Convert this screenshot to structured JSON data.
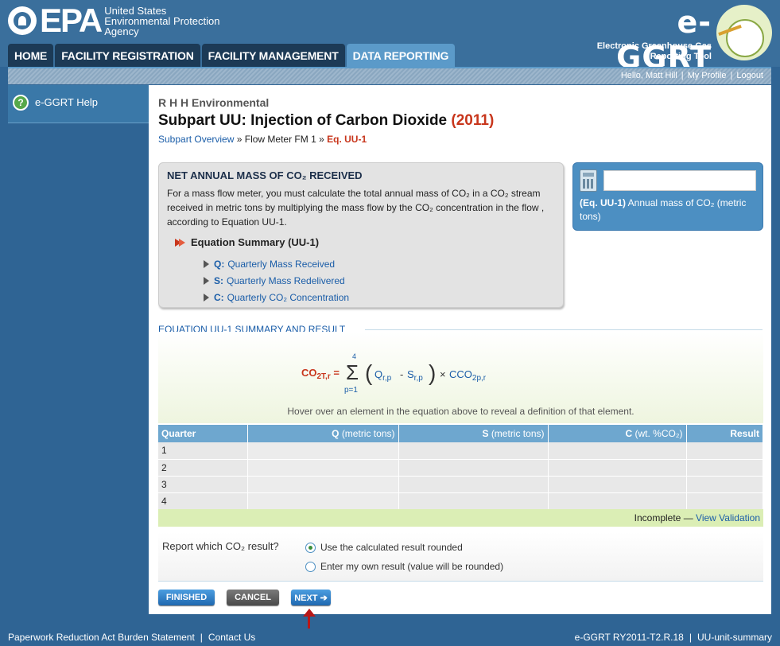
{
  "header": {
    "epa_word": "EPA",
    "agency_line1": "United States",
    "agency_line2": "Environmental Protection",
    "agency_line3": "Agency",
    "app_title": "e-GGRT",
    "app_subtitle_line1": "Electronic Greenhouse Gas",
    "app_subtitle_line2": "Reporting Tool"
  },
  "nav": {
    "tabs": [
      {
        "label": "HOME"
      },
      {
        "label": "FACILITY REGISTRATION"
      },
      {
        "label": "FACILITY MANAGEMENT"
      },
      {
        "label": "DATA REPORTING"
      }
    ],
    "active_index": 3
  },
  "user_bar": {
    "greeting": "Hello, Matt Hill",
    "profile": "My Profile",
    "logout": "Logout"
  },
  "sidebar": {
    "help_label": "e-GGRT Help"
  },
  "main": {
    "facility": "R H H Environmental",
    "title": "Subpart UU: Injection of Carbon Dioxide",
    "year": "(2011)",
    "breadcrumb": {
      "link1": "Subpart Overview",
      "sep": "»",
      "item2": "Flow Meter FM 1",
      "current": "Eq. UU-1"
    }
  },
  "info_box": {
    "title": "NET ANNUAL MASS OF CO₂ RECEIVED",
    "text": "For a mass flow meter, you must calculate the total annual mass of CO₂ in a CO₂ stream received in metric tons by multiplying the mass flow by the CO₂ concentration in the flow , according to Equation UU-1.",
    "summary_head": "Equation Summary (UU-1)",
    "items": [
      {
        "key": "Q:",
        "label": "Quarterly Mass Received"
      },
      {
        "key": "S:",
        "label": "Quarterly Mass Redelivered"
      },
      {
        "key": "C:",
        "label": "Quarterly CO₂ Concentration"
      }
    ]
  },
  "result_box": {
    "input_value": "",
    "label_bold": "(Eq. UU-1)",
    "label": "Annual mass of CO₂ (metric tons)"
  },
  "equation": {
    "section_title": "EQUATION UU-1 SUMMARY AND RESULT",
    "lhs": "CO",
    "lhs_sub": "2T,r",
    "sum_top": "4",
    "sum_bot": "p=1",
    "q": "Q",
    "q_sub": "r,p",
    "s": "S",
    "s_sub": "r,p",
    "c": "C",
    "c_sub": "CO",
    "c_sub2": "2p,r",
    "hint": "Hover over an element in the equation above to reveal a definition of that element."
  },
  "table": {
    "headers": [
      {
        "label": "Quarter",
        "unit": ""
      },
      {
        "label": "Q",
        "unit": "(metric tons)"
      },
      {
        "label": "S",
        "unit": "(metric tons)"
      },
      {
        "label": "C",
        "unit": "(wt. %CO₂)"
      },
      {
        "label": "Result",
        "unit": ""
      }
    ],
    "rows": [
      {
        "quarter": "1"
      },
      {
        "quarter": "2"
      },
      {
        "quarter": "3"
      },
      {
        "quarter": "4"
      }
    ],
    "status": "Incomplete —",
    "validation_link": "View Validation"
  },
  "report": {
    "question": "Report which CO₂ result?",
    "option1": "Use the calculated result rounded",
    "option2": "Enter my own result (value will be rounded)",
    "selected": 0
  },
  "buttons": {
    "finished": "FINISHED",
    "cancel": "CANCEL",
    "next": "NEXT ➔"
  },
  "footer": {
    "left1": "Paperwork Reduction Act Burden Statement",
    "left2": "Contact Us",
    "right1": "e-GGRT RY2011-T2.R.18",
    "right2": "UU-unit-summary"
  }
}
